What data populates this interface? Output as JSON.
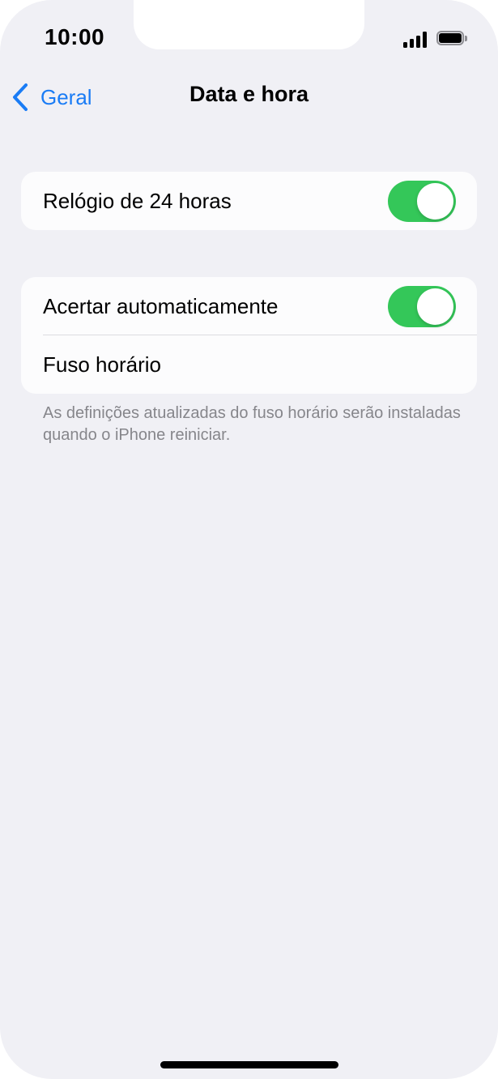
{
  "status_bar": {
    "time": "10:00",
    "signal_icon": "cellular-signal-icon",
    "battery_icon": "battery-icon",
    "battery_level": 1.0
  },
  "nav": {
    "back_icon": "chevron-left-icon",
    "back_label": "Geral",
    "title": "Data e hora"
  },
  "colors": {
    "accent": "#1a7cf5",
    "toggle_on": "#34c759",
    "background": "#f0f0f5"
  },
  "groups": [
    {
      "rows": [
        {
          "label": "Relógio de 24 horas",
          "type": "toggle",
          "value": true
        }
      ]
    },
    {
      "rows": [
        {
          "label": "Acertar automaticamente",
          "type": "toggle",
          "value": true
        },
        {
          "label": "Fuso horário",
          "type": "link"
        }
      ],
      "footer": "As definições atualizadas do fuso horário serão instaladas quando o iPhone reiniciar."
    }
  ]
}
